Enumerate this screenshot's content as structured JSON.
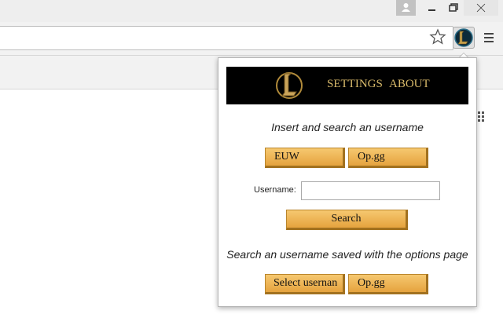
{
  "window": {
    "icons": [
      "profile-icon",
      "minimize-icon",
      "restore-icon",
      "close-icon"
    ]
  },
  "toolbar": {
    "address_value": "",
    "icons": [
      "star-icon",
      "lol-logo-icon",
      "hamburger-menu-icon",
      "apps-grid-icon"
    ]
  },
  "popup": {
    "nav": {
      "settings": "SETTINGS",
      "about": "ABOUT"
    },
    "instruction_1": "Insert and search an username",
    "region_button": "EUW",
    "site_button": "Op.gg",
    "username_label": "Username:",
    "username_value": "",
    "search_button": "Search",
    "instruction_2": "Search an username saved with the options page",
    "select_button": "Select usernan",
    "site_button_2": "Op.gg"
  },
  "colors": {
    "button_gold": "#e5a33e",
    "banner_bg": "#000000",
    "nav_text": "#d7b96a"
  }
}
